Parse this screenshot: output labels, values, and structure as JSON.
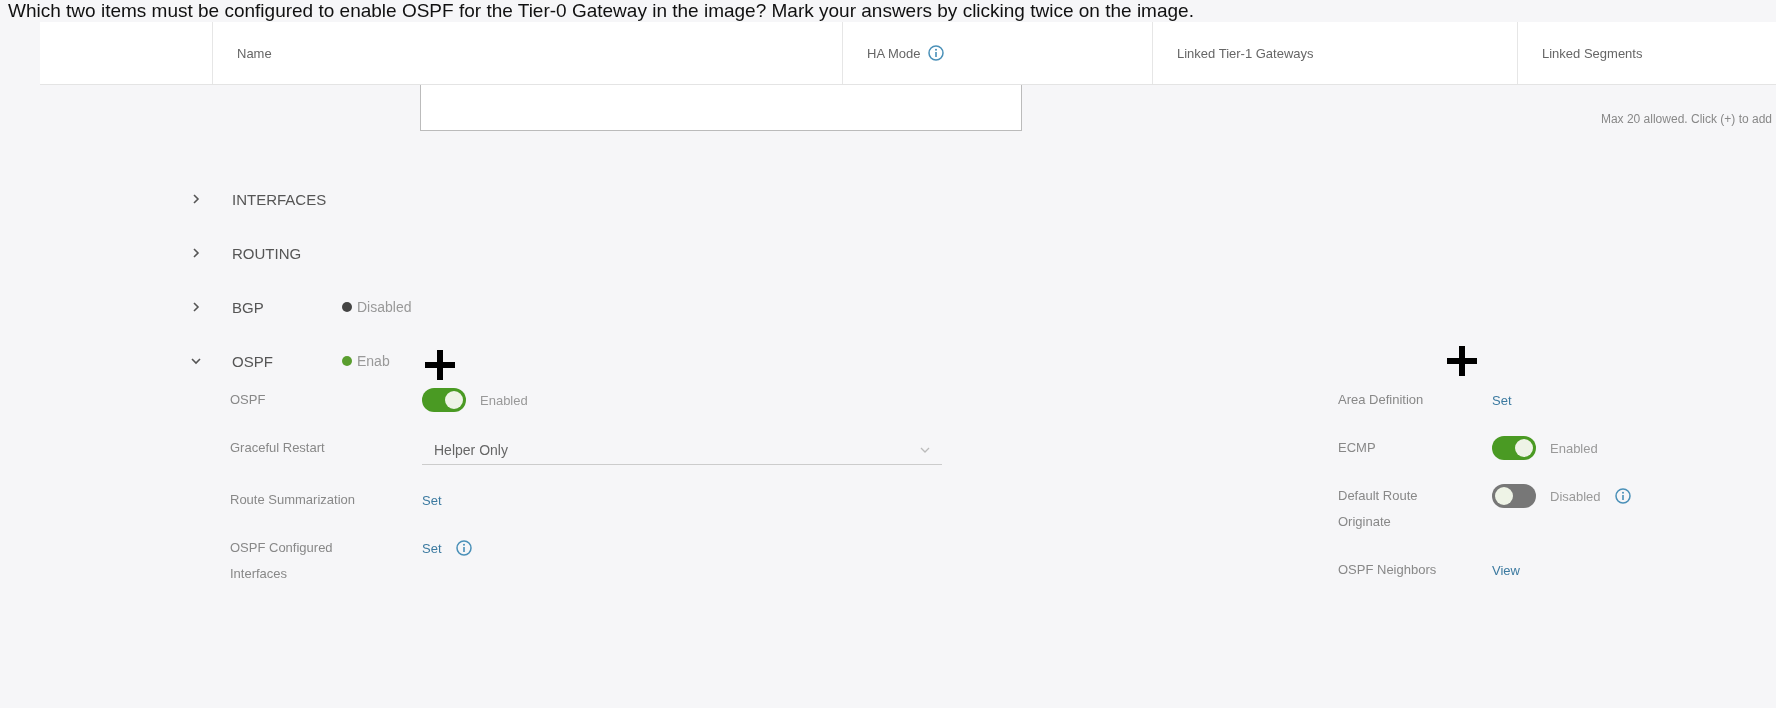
{
  "question": "Which two items must be configured to enable OSPF for the Tier-0 Gateway in the image? Mark your answers by clicking twice on the image.",
  "table": {
    "columns": [
      {
        "label": "Name",
        "info": false
      },
      {
        "label": "HA Mode",
        "info": true
      },
      {
        "label": "Linked Tier-1 Gateways",
        "info": false
      },
      {
        "label": "Linked Segments",
        "info": false
      }
    ]
  },
  "segments_hint": "Max 20 allowed. Click (+) to add",
  "sections": [
    {
      "label": "INTERFACES",
      "expanded": false
    },
    {
      "label": "ROUTING",
      "expanded": false
    },
    {
      "label": "BGP",
      "expanded": false,
      "status": "Disabled",
      "color": "#444444",
      "marked": false
    },
    {
      "label": "OSPF",
      "expanded": true,
      "status": "Enab",
      "color": "#5a9e2f",
      "marked": true
    }
  ],
  "left_fields": [
    {
      "label": "OSPF",
      "kind": "toggle",
      "on": true,
      "text": "Enabled",
      "info": false
    },
    {
      "label": "Graceful Restart",
      "kind": "select",
      "value": "Helper Only"
    },
    {
      "label": "Route Summarization",
      "kind": "link",
      "text": "Set",
      "info": false
    },
    {
      "label": "OSPF Configured Interfaces",
      "kind": "link",
      "text": "Set",
      "info": true
    }
  ],
  "right_fields": [
    {
      "label": "Area Definition",
      "kind": "link",
      "text": "Set",
      "info": false,
      "marked": true
    },
    {
      "label": "ECMP",
      "kind": "toggle",
      "on": true,
      "text": "Enabled",
      "info": false
    },
    {
      "label": "Default Route Originate",
      "kind": "toggle",
      "on": false,
      "text": "Disabled",
      "info": true
    },
    {
      "label": "OSPF Neighbors",
      "kind": "link",
      "text": "View",
      "info": false
    }
  ]
}
